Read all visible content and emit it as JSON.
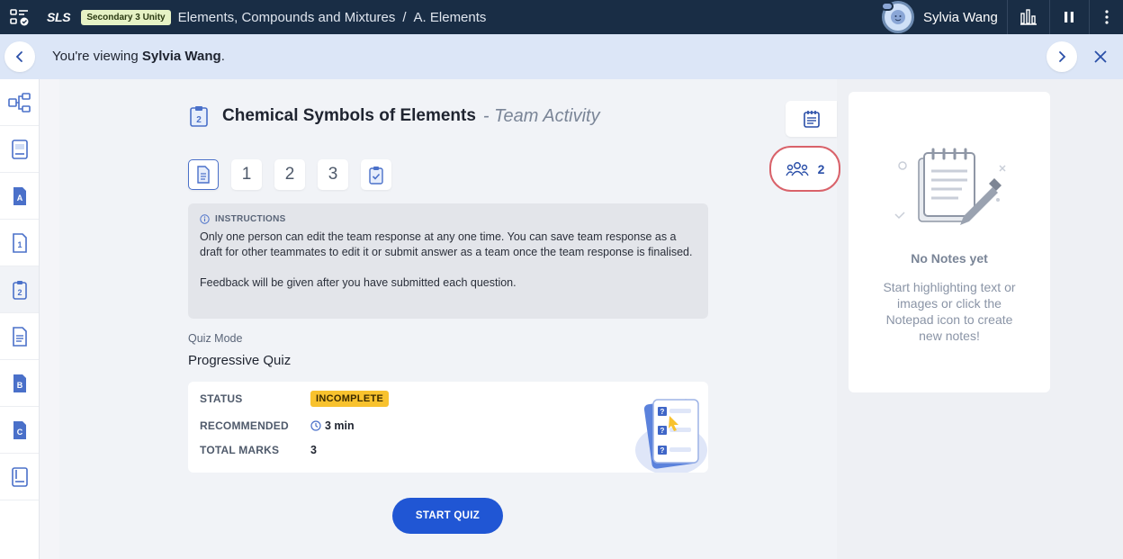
{
  "topbar": {
    "logo": "SLS",
    "class_badge": "Secondary 3 Unity",
    "breadcrumb": [
      "Elements, Compounds and Mixtures",
      "A. Elements"
    ],
    "breadcrumb_separator": "/",
    "user_name": "Sylvia Wang",
    "icons": [
      "menu-icon",
      "monitor-icon",
      "pause-icon",
      "more-vertical-icon"
    ]
  },
  "banner": {
    "prefix": "You're viewing",
    "name": "Sylvia Wang",
    "suffix": "."
  },
  "sidebar": {
    "items": [
      {
        "icon": "mindmap-icon",
        "label": ""
      },
      {
        "icon": "book-icon",
        "label": ""
      },
      {
        "icon": "page-a-icon",
        "label": "A"
      },
      {
        "icon": "page-1-icon",
        "label": "1"
      },
      {
        "icon": "clipboard-2-icon",
        "label": "2",
        "active": true
      },
      {
        "icon": "document-icon",
        "label": ""
      },
      {
        "icon": "page-b-icon",
        "label": "B"
      },
      {
        "icon": "page-c-icon",
        "label": "C"
      },
      {
        "icon": "book-end-icon",
        "label": ""
      }
    ]
  },
  "activity": {
    "icon_label": "2",
    "title": "Chemical Symbols of Elements",
    "subtitle": "- Team Activity",
    "steps": [
      "1",
      "2",
      "3"
    ],
    "instructions_heading": "INSTRUCTIONS",
    "instructions_p1": "Only one person can edit the team response at any one time. You can save team response as a draft for other teammates to edit it or submit answer as a team once the team response is finalised.",
    "instructions_p2": "Feedback will be given after you have submitted each question.",
    "quiz_mode_label": "Quiz Mode",
    "quiz_mode_value": "Progressive Quiz",
    "status_label": "STATUS",
    "status_value": "INCOMPLETE",
    "recommended_label": "RECOMMENDED",
    "recommended_value": "3 min",
    "total_marks_label": "TOTAL MARKS",
    "total_marks_value": "3",
    "start_button": "START QUIZ"
  },
  "team": {
    "count": "2"
  },
  "notes": {
    "title": "No Notes yet",
    "description": "Start highlighting text or images or click the Notepad icon to create new notes!"
  },
  "colors": {
    "topbar": "#192d45",
    "banner": "#dce6f7",
    "primary": "#2056d4",
    "status_incomplete": "#f8c22e",
    "team_highlight": "#d9626a"
  }
}
